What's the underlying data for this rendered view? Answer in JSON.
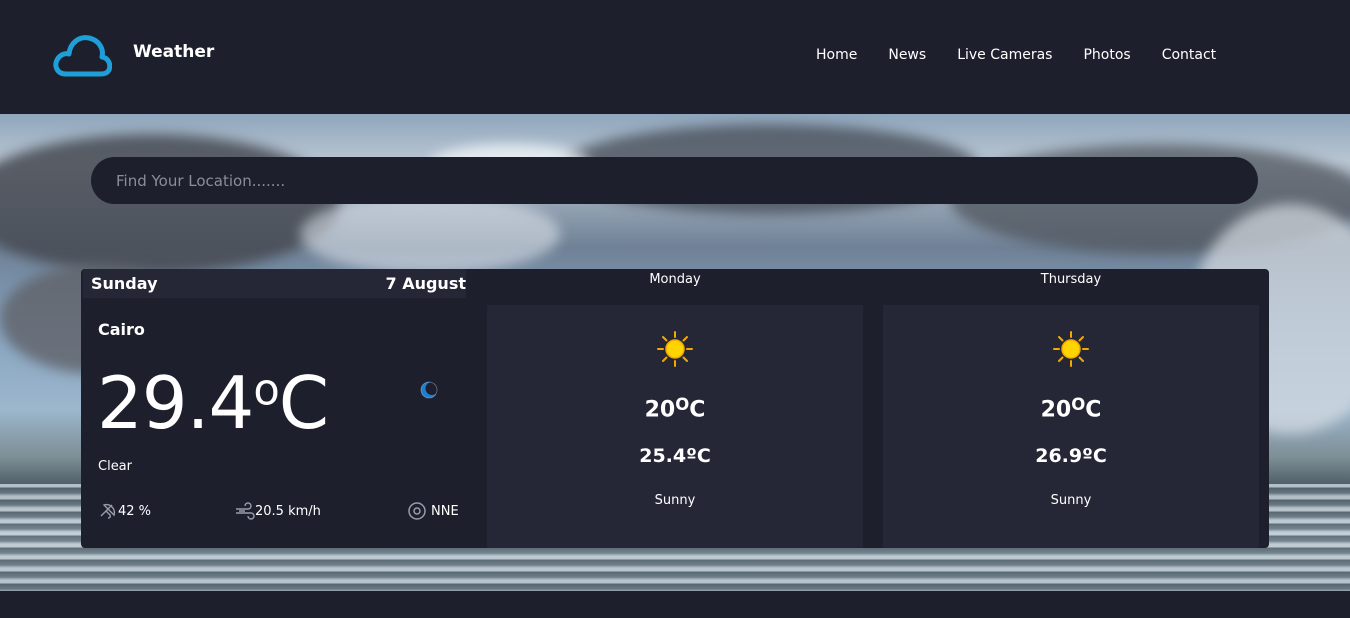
{
  "brand": {
    "name": "Weather",
    "icon": "cloud-icon",
    "accent": "#1e9fd8"
  },
  "nav": {
    "items": [
      "Home",
      "News",
      "Live Cameras",
      "Photos",
      "Contact"
    ]
  },
  "search": {
    "placeholder": "Find Your Location......."
  },
  "today": {
    "day": "Sunday",
    "date": "7 August",
    "location": "Cairo",
    "temp_value": "29.4",
    "temp_sup": "o",
    "temp_unit": "C",
    "condition": "Clear",
    "icon": "moon-icon",
    "humidity": "42 %",
    "wind": "20.5 km/h",
    "direction": "NNE"
  },
  "forecast": [
    {
      "day": "Monday",
      "max_value": "20",
      "max_sup": "O",
      "max_unit": "C",
      "min": "25.4ºC",
      "condition": "Sunny",
      "icon": "sun-icon"
    },
    {
      "day": "Thursday",
      "max_value": "20",
      "max_sup": "O",
      "max_unit": "C",
      "min": "26.9ºC",
      "condition": "Sunny",
      "icon": "sun-icon"
    }
  ],
  "colors": {
    "background": "#1e1f2d",
    "panel": "#252736",
    "sun": "#ffc800"
  }
}
